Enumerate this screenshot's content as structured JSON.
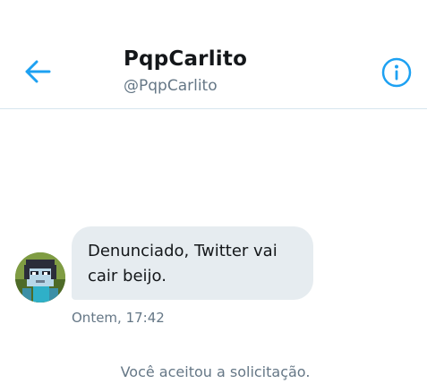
{
  "header": {
    "display_name": "PqpCarlito",
    "handle": "@PqpCarlito",
    "back_icon": "arrow-left-icon",
    "info_icon": "info-icon"
  },
  "conversation": {
    "messages": [
      {
        "text": "Denunciado, Twitter vai cair beijo.",
        "timestamp": "Ontem, 17:42"
      }
    ],
    "system_note": "Você aceitou a solicitação."
  },
  "colors": {
    "accent": "#1da1f2",
    "bubble_bg": "#e6ecf0",
    "text_primary": "#14171a",
    "text_secondary": "#657786",
    "divider": "#d6e6ee"
  }
}
